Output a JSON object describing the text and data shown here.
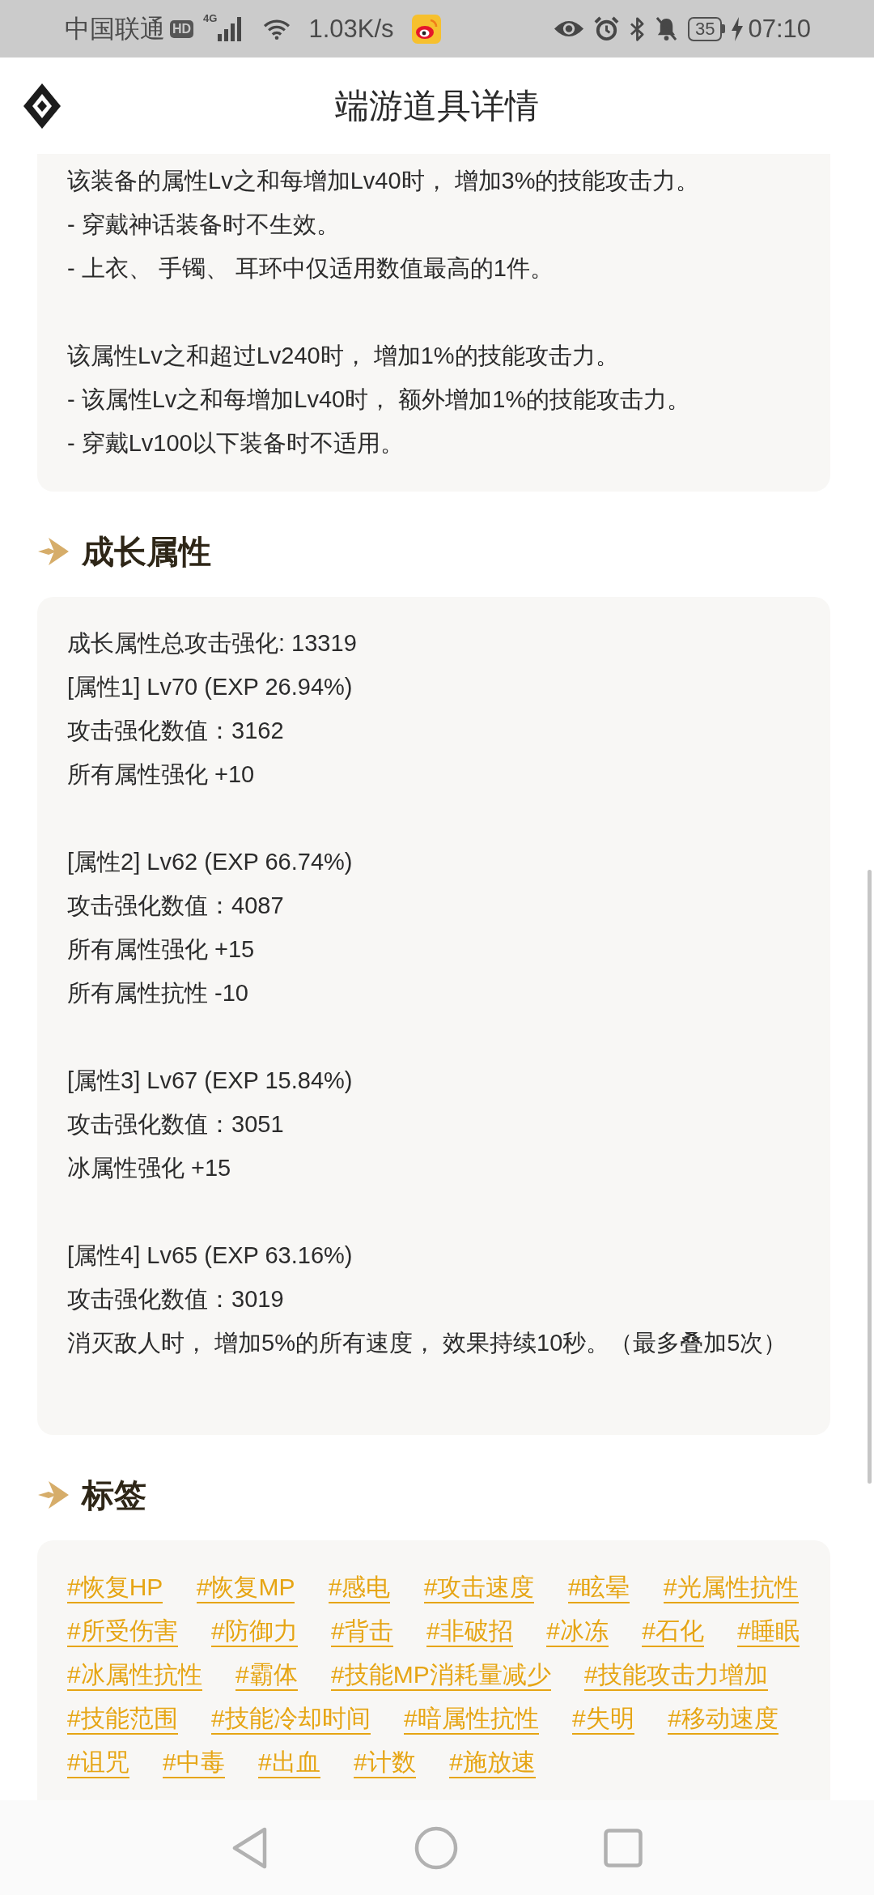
{
  "status_bar": {
    "carrier": "中国联通",
    "hd_badge": "HD",
    "network_type": "4G",
    "speed": "1.03K/s",
    "battery": "35",
    "time": "07:10"
  },
  "header": {
    "title": "端游道具详情"
  },
  "sections": [
    {
      "kind": "text",
      "paragraphs": [
        [
          "该装备的属性Lv之和每增加Lv40时， 增加3%的技能攻击力。",
          "- 穿戴神话装备时不生效。",
          "- 上衣、 手镯、 耳环中仅适用数值最高的1件。"
        ],
        [
          "该属性Lv之和超过Lv240时， 增加1%的技能攻击力。",
          "- 该属性Lv之和每增加Lv40时， 额外增加1%的技能攻击力。",
          "- 穿戴Lv100以下装备时不适用。"
        ]
      ]
    },
    {
      "kind": "text",
      "heading": "成长属性",
      "paragraphs": [
        [
          "成长属性总攻击强化: 13319",
          "[属性1] Lv70 (EXP 26.94%)",
          "攻击强化数值：3162",
          "所有属性强化 +10"
        ],
        [
          "[属性2] Lv62 (EXP 66.74%)",
          "攻击强化数值：4087",
          "所有属性强化 +15",
          "所有属性抗性 -10"
        ],
        [
          "[属性3] Lv67 (EXP 15.84%)",
          "攻击强化数值：3051",
          "冰属性强化 +15"
        ],
        [
          "[属性4] Lv65 (EXP 63.16%)",
          "攻击强化数值：3019",
          "消灭敌人时， 增加5%的所有速度， 效果持续10秒。（最多叠加5次）"
        ]
      ]
    },
    {
      "kind": "tags",
      "heading": "标签",
      "tags": [
        "#恢复HP",
        "#恢复MP",
        "#感电",
        "#攻击速度",
        "#眩晕",
        "#光属性抗性",
        "#所受伤害",
        "#防御力",
        "#背击",
        "#非破招",
        "#冰冻",
        "#石化",
        "#睡眠",
        "#冰属性抗性",
        "#霸体",
        "#技能MP消耗量减少",
        "#技能攻击力增加",
        "#技能范围",
        "#技能冷却时间",
        "#暗属性抗性",
        "#失明",
        "#移动速度",
        "#诅咒",
        "#中毒",
        "#出血",
        "#计数",
        "#施放速"
      ]
    }
  ]
}
